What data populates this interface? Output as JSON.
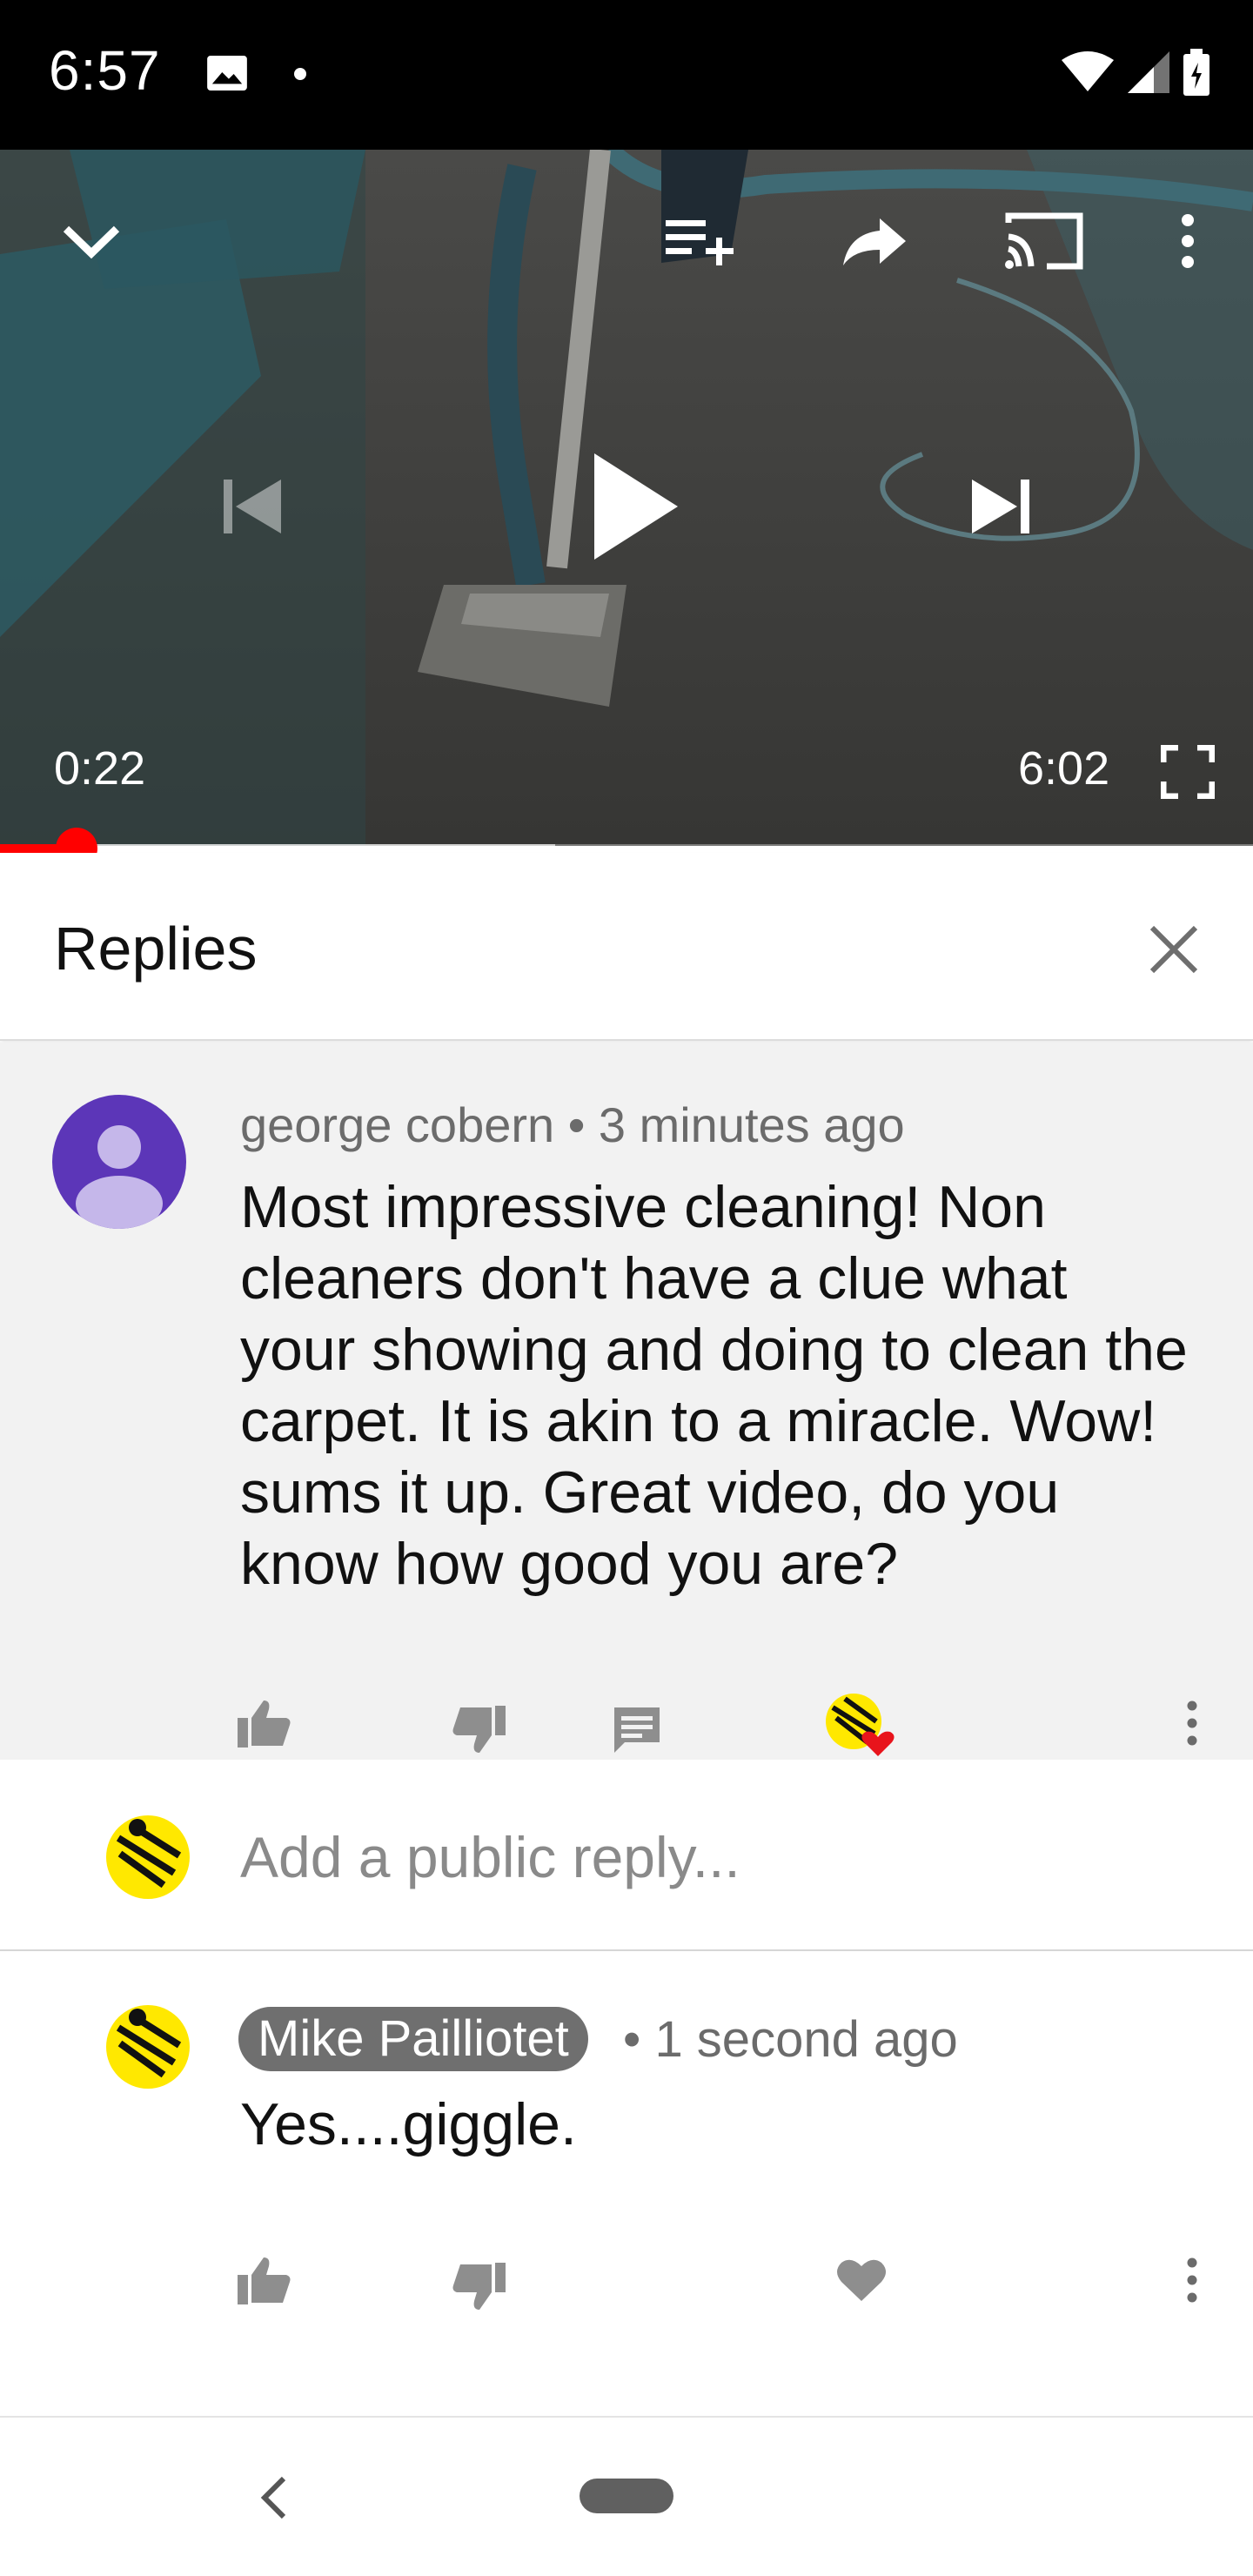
{
  "status_bar": {
    "time": "6:57",
    "icons": [
      "image-icon",
      "notification-dot-icon",
      "wifi-icon",
      "signal-icon",
      "battery-icon"
    ]
  },
  "player": {
    "current_time": "0:22",
    "duration": "6:02",
    "progress_fraction": 0.061,
    "buffered_fraction": 0.443,
    "controls": [
      "collapse-icon",
      "add-to-queue-icon",
      "share-icon",
      "cast-icon",
      "more-icon",
      "previous-icon",
      "play-icon",
      "next-icon",
      "fullscreen-icon"
    ]
  },
  "replies": {
    "title": "Replies"
  },
  "parent_comment": {
    "author": "george cobern",
    "separator": "•",
    "time": "3 minutes ago",
    "text": "Most impressive cleaning! Non cleaners don't have a clue what your showing and doing to clean the carpet. It is akin to a miracle. Wow! sums it up. Great video, do you know how good you are?"
  },
  "reply_input": {
    "placeholder": "Add a public reply..."
  },
  "reply_comment": {
    "author": "Mike Pailliotet",
    "separator": "•",
    "time": "1 second ago",
    "text": "Yes....giggle."
  },
  "colors": {
    "progress_played": "#ff0000",
    "parent_bg": "#f2f2f2",
    "avatar_purple": "#5c36b8",
    "avatar_yellow": "#ffe800",
    "heart_red": "#e8141c"
  }
}
